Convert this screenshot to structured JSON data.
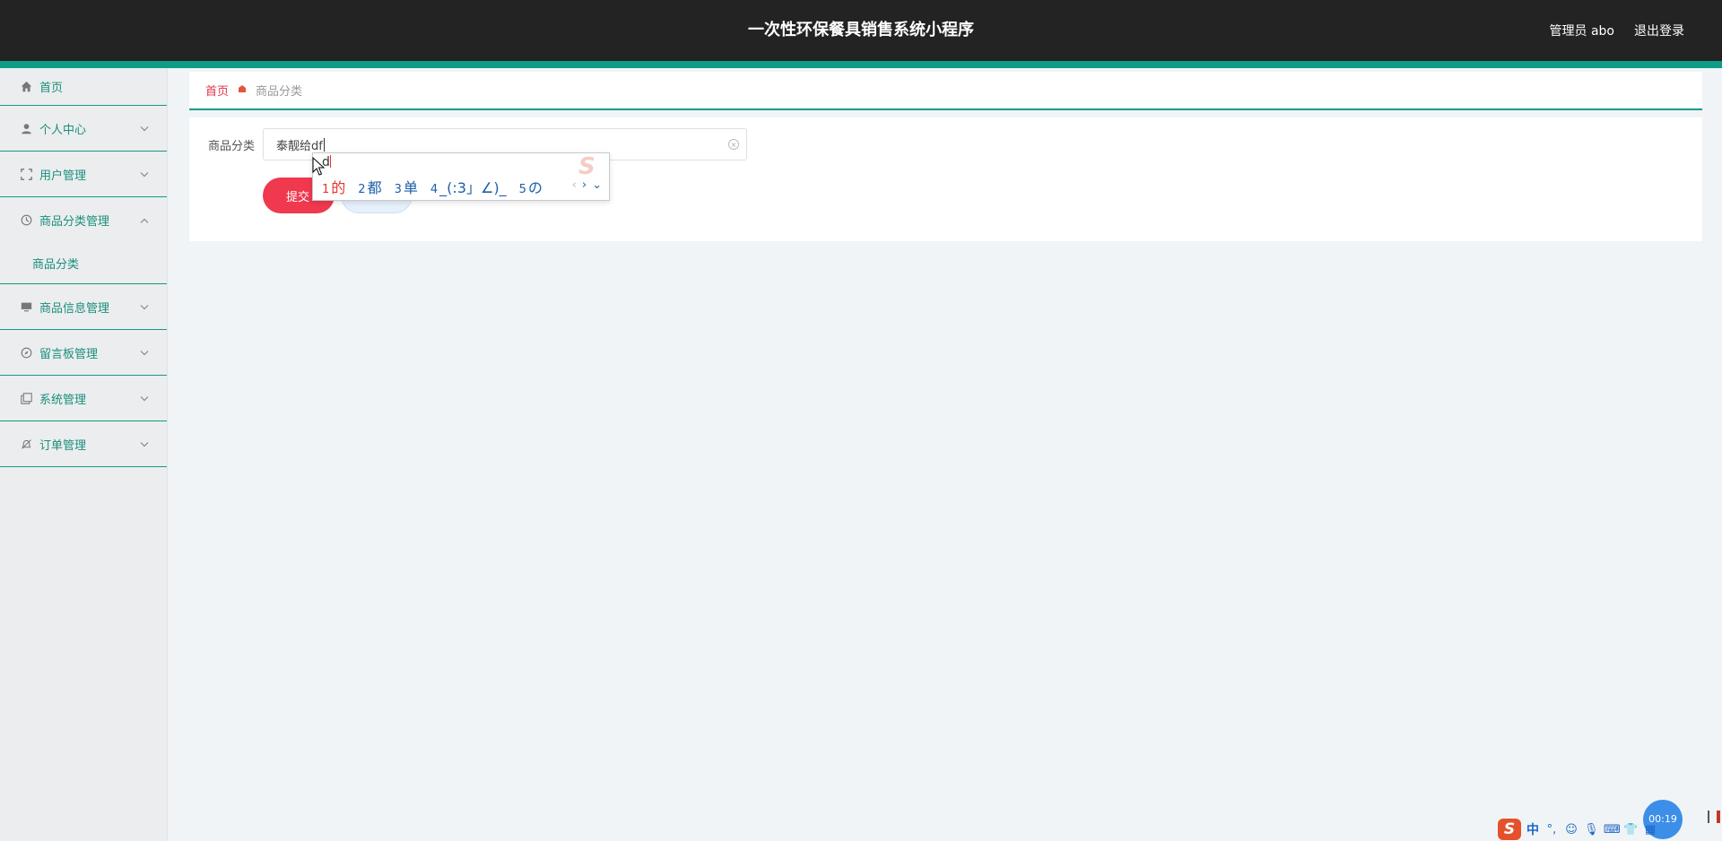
{
  "header": {
    "title": "一次性环保餐具销售系统小程序",
    "user_label": "管理员 abo",
    "logout_label": "退出登录"
  },
  "sidebar": {
    "items": [
      {
        "label": "首页",
        "icon": "home-icon"
      },
      {
        "label": "个人中心",
        "icon": "user-icon"
      },
      {
        "label": "用户管理",
        "icon": "fullscreen-icon"
      },
      {
        "label": "商品分类管理",
        "icon": "clock-icon",
        "expanded": true,
        "children": [
          {
            "label": "商品分类"
          }
        ]
      },
      {
        "label": "商品信息管理",
        "icon": "monitor-icon"
      },
      {
        "label": "留言板管理",
        "icon": "compass-icon"
      },
      {
        "label": "系统管理",
        "icon": "copy-icon"
      },
      {
        "label": "订单管理",
        "icon": "bell-off-icon"
      }
    ]
  },
  "breadcrumb": {
    "home": "首页",
    "current": "商品分类"
  },
  "form": {
    "field_label": "商品分类",
    "field_value": "泰靓给df",
    "submit_label": "提交"
  },
  "ime": {
    "composition": "d",
    "candidates": [
      {
        "num": "1",
        "text": "的"
      },
      {
        "num": "2",
        "text": "都"
      },
      {
        "num": "3",
        "text": "单"
      },
      {
        "num": "4",
        "text": "_(:3」∠)_"
      },
      {
        "num": "5",
        "text": "の"
      }
    ]
  },
  "tray": {
    "input_mode": "中",
    "timer": "00:19"
  },
  "colors": {
    "header_bg": "#232323",
    "accent": "#0e9c86",
    "primary_button": "#f0384f",
    "breadcrumb_home": "#e3324a"
  }
}
